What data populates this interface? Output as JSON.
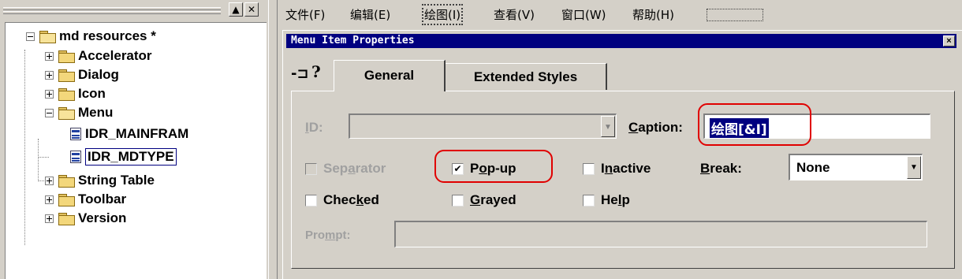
{
  "tree": {
    "toolbar_minimize": "▲",
    "toolbar_close": "✕",
    "root": "md resources *",
    "items": [
      {
        "label": "Accelerator",
        "icon": "folder-icon",
        "expanded": false
      },
      {
        "label": "Dialog",
        "icon": "folder-icon",
        "expanded": false
      },
      {
        "label": "Icon",
        "icon": "folder-icon",
        "expanded": false
      },
      {
        "label": "Menu",
        "icon": "folder-open-icon",
        "expanded": true
      },
      {
        "label": "IDR_MAINFRAM",
        "icon": "menu-resource-icon",
        "child": true
      },
      {
        "label": "IDR_MDTYPE",
        "icon": "menu-resource-icon",
        "child": true,
        "selected": true
      },
      {
        "label": "String Table",
        "icon": "folder-icon",
        "expanded": false
      },
      {
        "label": "Toolbar",
        "icon": "folder-icon",
        "expanded": false
      },
      {
        "label": "Version",
        "icon": "folder-icon",
        "expanded": false
      }
    ]
  },
  "menubar": {
    "items": [
      "文件(F)",
      "编辑(E)",
      "绘图(I)",
      "查看(V)",
      "窗口(W)",
      "帮助(H)"
    ],
    "focused": "绘图(I)"
  },
  "props": {
    "title": "Menu Item Properties",
    "close": "×",
    "pin_icon": "pushpin-icon",
    "help_icon": "help-icon",
    "pin_glyph": "-⊐",
    "help_glyph": "?",
    "tabs": [
      "General",
      "Extended Styles"
    ],
    "active_tab": "General",
    "id_label": "ID:",
    "id_value": "",
    "caption_label": "Caption:",
    "caption_value": "绘图[&I]",
    "separator": "Separator",
    "popup": "Pop-up",
    "inactive": "Inactive",
    "break_label": "Break:",
    "break_value": "None",
    "checked": "Checked",
    "grayed": "Grayed",
    "help": "Help",
    "prompt_label": "Prompt:",
    "prompt_value": "",
    "popup_checked": "✔",
    "dropdown_glyph": "▼",
    "highlight_color": "#e00000",
    "title_bar_color": "#000080"
  }
}
